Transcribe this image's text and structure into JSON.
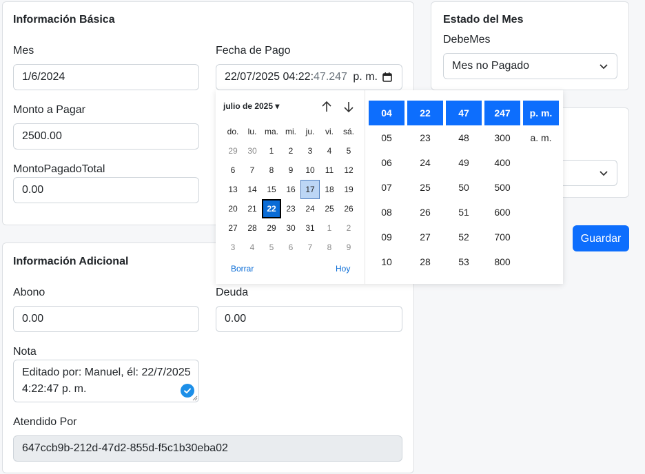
{
  "basic": {
    "title": "Información Básica",
    "mes_label": "Mes",
    "mes_value": "1/6/2024",
    "fecha_label": "Fecha de Pago",
    "fecha_value_main": "22/07/2025 04:22:",
    "fecha_value_sec": "47.247",
    "fecha_value_ampm": "p. m.",
    "monto_label": "Monto a Pagar",
    "monto_value": "2500.00",
    "pagado_label": "MontoPagadoTotal",
    "pagado_value": "0.00"
  },
  "additional": {
    "title": "Información Adicional",
    "abono_label": "Abono",
    "abono_value": "0.00",
    "deuda_label": "Deuda",
    "deuda_value": "0.00",
    "nota_label": "Nota",
    "nota_line1": "Editado por: Manuel, él: 22/7/2025",
    "nota_line2": "4:22:47 p. m.",
    "atendido_label": "Atendido Por",
    "atendido_value": "647ccb9b-212d-47d2-855d-f5c1b30eba02"
  },
  "status": {
    "title": "Estado del Mes",
    "debe_label": "DebeMes",
    "debe_value": "Mes no Pagado"
  },
  "actions": {
    "save_label": "Guardar"
  },
  "datepicker": {
    "month_label": "julio de 2025 ▾",
    "weekdays": [
      "do.",
      "lu.",
      "ma.",
      "mi.",
      "ju.",
      "vi.",
      "sá."
    ],
    "weeks": [
      [
        "29",
        "30",
        "1",
        "2",
        "3",
        "4",
        "5"
      ],
      [
        "6",
        "7",
        "8",
        "9",
        "10",
        "11",
        "12"
      ],
      [
        "13",
        "14",
        "15",
        "16",
        "17",
        "18",
        "19"
      ],
      [
        "20",
        "21",
        "22",
        "23",
        "24",
        "25",
        "26"
      ],
      [
        "27",
        "28",
        "29",
        "30",
        "31",
        "1",
        "2"
      ],
      [
        "3",
        "4",
        "5",
        "6",
        "7",
        "8",
        "9"
      ]
    ],
    "selected_day": "22",
    "today_day": "17",
    "clear_label": "Borrar",
    "today_label": "Hoy",
    "hours": [
      "04",
      "05",
      "06",
      "07",
      "08",
      "09",
      "10"
    ],
    "minutes": [
      "22",
      "23",
      "24",
      "25",
      "26",
      "27",
      "28"
    ],
    "seconds": [
      "47",
      "48",
      "49",
      "50",
      "51",
      "52",
      "53"
    ],
    "millis": [
      "247",
      "300",
      "400",
      "500",
      "600",
      "700",
      "800"
    ],
    "ampm": [
      "p. m.",
      "a. m."
    ]
  }
}
